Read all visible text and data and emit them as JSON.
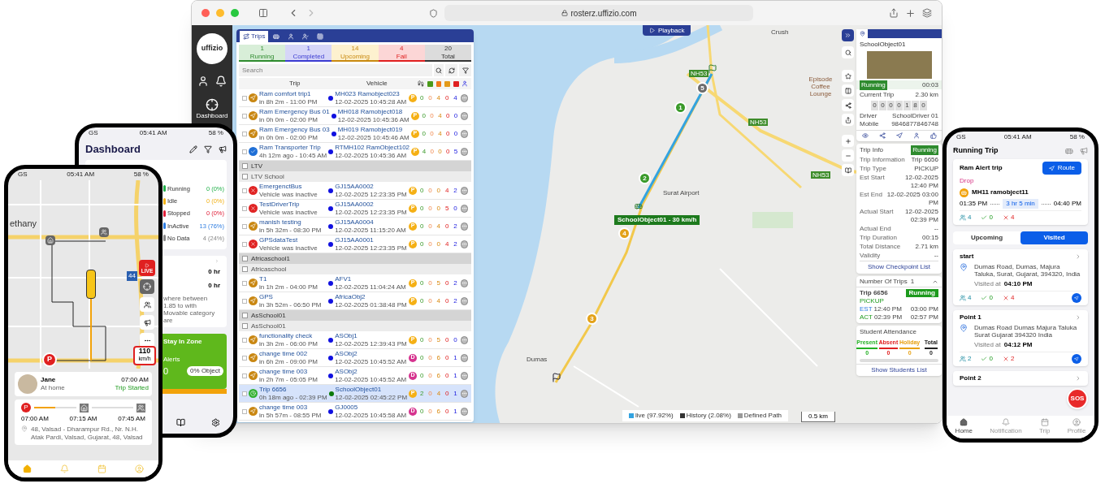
{
  "browser": {
    "url": "rosterz.uffizio.com"
  },
  "sidebar": {
    "logo": "uffizio",
    "items": [
      {
        "label": "Dashboard",
        "selected": true
      }
    ]
  },
  "map": {
    "playback": "Playback",
    "labels": [
      {
        "text": "Crush",
        "kind": "place"
      },
      {
        "text": "NH53",
        "kind": "road"
      },
      {
        "text": "Episode Coffee Lounge",
        "kind": "poi"
      },
      {
        "text": "NH53",
        "kind": "road"
      },
      {
        "text": "NH53",
        "kind": "road"
      },
      {
        "text": "Surat Airport",
        "kind": "place"
      },
      {
        "text": "Dumas",
        "kind": "place"
      }
    ],
    "markers": [
      {
        "label": "5",
        "color": "#6b6b6b"
      },
      {
        "label": "1",
        "color": "#3a9a2a"
      },
      {
        "label": "2",
        "color": "#3a9a2a"
      },
      {
        "label": "4",
        "color": "#e3a21a"
      },
      {
        "label": "3",
        "color": "#e3a21a"
      }
    ],
    "vehicle_label": "SchoolObject01 - 30 km/h",
    "legend": [
      {
        "label": "live (97.92%)",
        "color": "#33a3e0"
      },
      {
        "label": "History (2.08%)",
        "color": "#333333"
      },
      {
        "label": "Defined Path",
        "color": "#9a9a9a"
      }
    ],
    "scale": "0.5 km"
  },
  "trips_panel": {
    "tabs": [
      {
        "kind": "trips",
        "label": "Trips",
        "selected": true
      },
      {
        "kind": "bus",
        "selected": false
      },
      {
        "kind": "person",
        "selected": false
      },
      {
        "kind": "driver",
        "selected": false
      },
      {
        "kind": "grid",
        "selected": false
      }
    ],
    "summary": [
      {
        "count": "1",
        "label": "Running",
        "color": "#2e8b2e"
      },
      {
        "count": "1",
        "label": "Completed",
        "color": "#3b3bd1"
      },
      {
        "count": "14",
        "label": "Upcoming",
        "color": "#c98a10"
      },
      {
        "count": "4",
        "label": "Fail",
        "color": "#e02020"
      },
      {
        "count": "20",
        "label": "Total",
        "color": "#333333"
      }
    ],
    "search": {
      "placeholder": "Search"
    },
    "columns": [
      "Trip",
      "Vehicle"
    ],
    "rows": [
      {
        "kind": "trip",
        "name": "Ram comfort trip1",
        "time": "in 8h 2m - 11:00 PM",
        "vehicle": "MH023 Ramobject023",
        "updated": "12-02-2025 10:45:28 AM",
        "status_icon": {
          "kind": "upcoming"
        },
        "badge": {
          "label": "P",
          "color": "#f5b015"
        },
        "color": "#1010e0",
        "counts": [
          "0",
          "0",
          "4",
          "0",
          "4"
        ],
        "selected": false
      },
      {
        "kind": "trip",
        "name": "Ram Emergency Bus 01",
        "time": "in 0h 0m - 02:00 PM",
        "vehicle": "MH018 Ramobject018",
        "updated": "12-02-2025 10:45:36 AM",
        "status_icon": {
          "kind": "upcoming"
        },
        "badge": {
          "label": "P",
          "color": "#f5b015"
        },
        "color": "#1010e0",
        "counts": [
          "0",
          "0",
          "4",
          "0",
          "0"
        ],
        "selected": false
      },
      {
        "kind": "trip",
        "name": "Ram Emergency Bus 03",
        "time": "in 0h 0m - 02:00 PM",
        "vehicle": "MH019 Ramobject019",
        "updated": "12-02-2025 10:45:46 AM",
        "status_icon": {
          "kind": "upcoming"
        },
        "badge": {
          "label": "P",
          "color": "#f5b015"
        },
        "color": "#1010e0",
        "counts": [
          "0",
          "0",
          "4",
          "0",
          "0"
        ],
        "selected": false
      },
      {
        "kind": "trip",
        "name": "Ram Transporter Trip",
        "time": "4h 12m ago - 10:45 AM",
        "vehicle": "RTMH102 RamObject102",
        "updated": "12-02-2025 10:45:36 AM",
        "status_icon": {
          "kind": "completed"
        },
        "badge": {
          "label": "P",
          "color": "#f5b015"
        },
        "color": "#1010e0",
        "counts": [
          "4",
          "0",
          "0",
          "0",
          "5"
        ],
        "selected": false
      },
      {
        "kind": "group",
        "name": "LTV",
        "checked": false
      },
      {
        "kind": "subgroup",
        "name": "LTV School",
        "checked": false
      },
      {
        "kind": "trip",
        "name": "EmergenctBus",
        "time": "Vehicle was inactive",
        "vehicle": "GJ15AA0002",
        "updated": "12-02-2025 12:23:35 PM",
        "status_icon": {
          "kind": "failed"
        },
        "badge": {
          "label": "P",
          "color": "#f5b015"
        },
        "color": "#1010e0",
        "counts": [
          "0",
          "0",
          "0",
          "4",
          "2"
        ],
        "selected": false
      },
      {
        "kind": "trip",
        "name": "TestDriverTrip",
        "time": "Vehicle was inactive",
        "vehicle": "GJ15AA0002",
        "updated": "12-02-2025 12:23:35 PM",
        "status_icon": {
          "kind": "failed"
        },
        "badge": {
          "label": "P",
          "color": "#f5b015"
        },
        "color": "#1010e0",
        "counts": [
          "0",
          "0",
          "0",
          "5",
          "0"
        ],
        "selected": false
      },
      {
        "kind": "trip",
        "name": "manish testing",
        "time": "in 5h 32m - 08:30 PM",
        "vehicle": "GJ15AA0004",
        "updated": "12-02-2025 11:15:20 AM",
        "status_icon": {
          "kind": "upcoming"
        },
        "badge": {
          "label": "P",
          "color": "#f5b015"
        },
        "color": "#1010e0",
        "counts": [
          "0",
          "0",
          "4",
          "0",
          "2"
        ],
        "selected": false
      },
      {
        "kind": "trip",
        "name": "GPSdataTest",
        "time": "Vehicle was inactive",
        "vehicle": "GJ15AA0001",
        "updated": "12-02-2025 12:23:35 PM",
        "status_icon": {
          "kind": "failed"
        },
        "badge": {
          "label": "P",
          "color": "#f5b015"
        },
        "color": "#1010e0",
        "counts": [
          "0",
          "0",
          "0",
          "4",
          "2"
        ],
        "selected": false
      },
      {
        "kind": "group",
        "name": "Africaschool1",
        "checked": false
      },
      {
        "kind": "subgroup",
        "name": "Africaschool",
        "checked": false
      },
      {
        "kind": "trip",
        "name": "T1",
        "time": "in 1h 2m - 04:00 PM",
        "vehicle": "AFV1",
        "updated": "12-02-2025 11:04:24 AM",
        "status_icon": {
          "kind": "upcoming"
        },
        "badge": {
          "label": "P",
          "color": "#f5b015"
        },
        "color": "#1010e0",
        "counts": [
          "0",
          "0",
          "5",
          "0",
          "2"
        ],
        "selected": false
      },
      {
        "kind": "trip",
        "name": "GPS",
        "time": "in 3h 52m - 06:50 PM",
        "vehicle": "AfricaObj2",
        "updated": "12-02-2025 01:38:48 PM",
        "status_icon": {
          "kind": "upcoming"
        },
        "badge": {
          "label": "P",
          "color": "#f5b015"
        },
        "color": "#1010e0",
        "counts": [
          "0",
          "0",
          "4",
          "0",
          "2"
        ],
        "selected": false
      },
      {
        "kind": "group",
        "name": "AsSchool01",
        "checked": false
      },
      {
        "kind": "subgroup",
        "name": "AsSchool01",
        "checked": false
      },
      {
        "kind": "trip",
        "name": "functionality check",
        "time": "in 3h 2m - 06:00 PM",
        "vehicle": "ASObj1",
        "updated": "12-02-2025 12:39:43 PM",
        "status_icon": {
          "kind": "upcoming"
        },
        "badge": {
          "label": "P",
          "color": "#f5b015"
        },
        "color": "#1010e0",
        "counts": [
          "0",
          "0",
          "5",
          "0",
          "0"
        ],
        "selected": false
      },
      {
        "kind": "trip",
        "name": "change time 002",
        "time": "in 6h 2m - 09:00 PM",
        "vehicle": "ASObj2",
        "updated": "12-02-2025 10:45:52 AM",
        "status_icon": {
          "kind": "upcoming"
        },
        "badge": {
          "label": "D",
          "color": "#d6338f"
        },
        "color": "#1010e0",
        "counts": [
          "0",
          "0",
          "6",
          "0",
          "1"
        ],
        "selected": false
      },
      {
        "kind": "trip",
        "name": "change time 003",
        "time": "in 2h 7m - 05:05 PM",
        "vehicle": "ASObj2",
        "updated": "12-02-2025 10:45:52 AM",
        "status_icon": {
          "kind": "upcoming"
        },
        "badge": {
          "label": "D",
          "color": "#d6338f"
        },
        "color": "#1010e0",
        "counts": [
          "0",
          "0",
          "6",
          "0",
          "1"
        ],
        "selected": false
      },
      {
        "kind": "trip",
        "name": "Trip 6656",
        "time": "0h 18m ago - 02:39 PM",
        "vehicle": "SchoolObject01",
        "updated": "12-02-2025 02:45:22 PM",
        "status_icon": {
          "kind": "running"
        },
        "badge": {
          "label": "P",
          "color": "#f5b015"
        },
        "color": "#0a7a0a",
        "counts": [
          "2",
          "0",
          "4",
          "0",
          "1"
        ],
        "selected": true
      },
      {
        "kind": "trip",
        "name": "change time 003",
        "time": "in 5h 57m - 08:55 PM",
        "vehicle": "GJ0005",
        "updated": "12-02-2025 10:45:58 AM",
        "status_icon": {
          "kind": "upcoming"
        },
        "badge": {
          "label": "D",
          "color": "#d6338f"
        },
        "color": "#1010e0",
        "counts": [
          "0",
          "0",
          "6",
          "0",
          "1"
        ],
        "selected": false
      }
    ]
  },
  "object_panel": {
    "name": "SchoolObject01",
    "status": "Running",
    "duration": "00:03",
    "current_trip": {
      "label": "Current Trip",
      "value": "2.30 km"
    },
    "odometer": [
      "0",
      "0",
      "0",
      "0",
      "1",
      "8",
      "0"
    ],
    "fields": [
      {
        "label": "Driver",
        "value": "SchoolDriver 01"
      },
      {
        "label": "Mobile",
        "value": "9846877846748"
      }
    ]
  },
  "trip_info": {
    "title": "Trip Info",
    "status": "Running",
    "fields": [
      {
        "label": "Trip Information",
        "value": "Trip 6656"
      },
      {
        "label": "Trip Type",
        "value": "PICKUP"
      },
      {
        "label": "Est Start",
        "value": "12-02-2025 12:40 PM"
      },
      {
        "label": "Est End",
        "value": "12-02-2025 03:00 PM"
      },
      {
        "label": "Actual Start",
        "value": "12-02-2025 02:39 PM"
      },
      {
        "label": "Actual End",
        "value": "--"
      },
      {
        "label": "Trip Duration",
        "value": "00:15"
      },
      {
        "label": "Total Distance",
        "value": "2.71 km"
      },
      {
        "label": "Validity",
        "value": "--"
      }
    ],
    "link": "Show Checkpoint List"
  },
  "number_of_trips": {
    "label": "Number Of Trips",
    "count": "1",
    "expanded": true,
    "trip": {
      "name": "Trip 6656",
      "status": "Running",
      "type": "PICKUP",
      "est_label": "EST",
      "est_start": "12:40 PM",
      "est_end": "03:00 PM",
      "act_label": "ACT",
      "act_start": "02:39 PM",
      "act_end": "02:57 PM"
    }
  },
  "attendance": {
    "title": "Student Attendance",
    "stats": [
      {
        "label": "Present",
        "value": "0",
        "color": "#22b022"
      },
      {
        "label": "Absent",
        "value": "0",
        "color": "#e02020"
      },
      {
        "label": "Holiday",
        "value": "0",
        "color": "#e8a010"
      },
      {
        "label": "Total",
        "value": "0",
        "color": "#222222"
      }
    ],
    "link": "Show Students List"
  },
  "dashboard_phone": {
    "status_bar": {
      "carrier": "GS",
      "time": "05:41 AM",
      "battery": "58 %"
    },
    "title": "Dashboard",
    "legend": [
      {
        "label": "Running",
        "value": "0 (0%)",
        "color": "#22b04a"
      },
      {
        "label": "Idle",
        "value": "0 (0%)",
        "color": "#f2b21a"
      },
      {
        "label": "Stopped",
        "value": "0 (0%)",
        "color": "#e0203a"
      },
      {
        "label": "InActive",
        "value": "13 (76%)",
        "color": "#2f7de0"
      },
      {
        "label": "No Data",
        "value": "4 (24%)",
        "color": "#888888"
      }
    ],
    "hours": [
      "0 hr",
      "0 hr"
    ],
    "note": "where between 1.85 to with Movable category are",
    "zone_card": {
      "title": "Stay In Zone",
      "alerts_label": "Alerts",
      "alerts": "0",
      "object": "0% Object"
    }
  },
  "tracking_phone": {
    "status_bar": {
      "carrier": "GS",
      "time": "05:41 AM",
      "battery": "58 %"
    },
    "map_label": "ethany",
    "highway": "44",
    "live": "LIVE",
    "speed": "110",
    "speed_unit": "km/h",
    "parking_pin": "P",
    "child": {
      "name": "Jane",
      "status": "At home",
      "time": "07:00 AM",
      "trip_status": "Trip Started"
    },
    "timeline": {
      "start_label": "P",
      "stops": [
        "07:00 AM",
        "07:15 AM",
        "07:45 AM"
      ],
      "progress": {
        "level": 0.5
      }
    },
    "address": "48, Valsad - Dharampur Rd., Nr. N.H. Atak Pardi, Valsad, Gujarat, 48, Valsad",
    "nav": [
      {
        "kind": "home",
        "selected": true
      },
      {
        "kind": "bell",
        "selected": false
      },
      {
        "kind": "calendar",
        "selected": false
      },
      {
        "kind": "profile",
        "selected": false
      }
    ]
  },
  "trip_phone": {
    "status_bar": {
      "carrier": "GS",
      "time": "05:41 AM",
      "battery": "58 %"
    },
    "title": "Running Trip",
    "trip": {
      "name": "Ram Alert trip",
      "button": "Route",
      "type": "Drop",
      "vehicle": "MH11 ramobject11",
      "start": "01:35 PM",
      "duration": "3 hr 5 min",
      "end": "04:40 PM",
      "counts": [
        "4",
        "0",
        "4"
      ]
    },
    "tabs": [
      {
        "label": "Upcoming",
        "selected": false
      },
      {
        "label": "Visited",
        "selected": true
      }
    ],
    "checkpoints": [
      {
        "name": "start",
        "address": "Dumas Road, Dumas, Majura Taluka, Surat, Gujarat, 394320, India",
        "visited_label": "Visited at",
        "visited": "04:10 PM",
        "counts": [
          "4",
          "0",
          "4"
        ]
      },
      {
        "name": "Point 1",
        "address": "Dumas Road Dumas Majura Taluka Surat Gujarat 394320 India",
        "visited_label": "Visited at",
        "visited": "04:12 PM",
        "counts": [
          "2",
          "0",
          "2"
        ]
      },
      {
        "name": "Point 2"
      }
    ],
    "sos": "SOS",
    "nav": [
      {
        "kind": "home",
        "label": "Home",
        "selected": true
      },
      {
        "kind": "bell",
        "label": "Notification",
        "selected": false
      },
      {
        "kind": "calendar",
        "label": "Trip",
        "selected": false
      },
      {
        "kind": "profile",
        "label": "Profile",
        "selected": false
      }
    ]
  }
}
